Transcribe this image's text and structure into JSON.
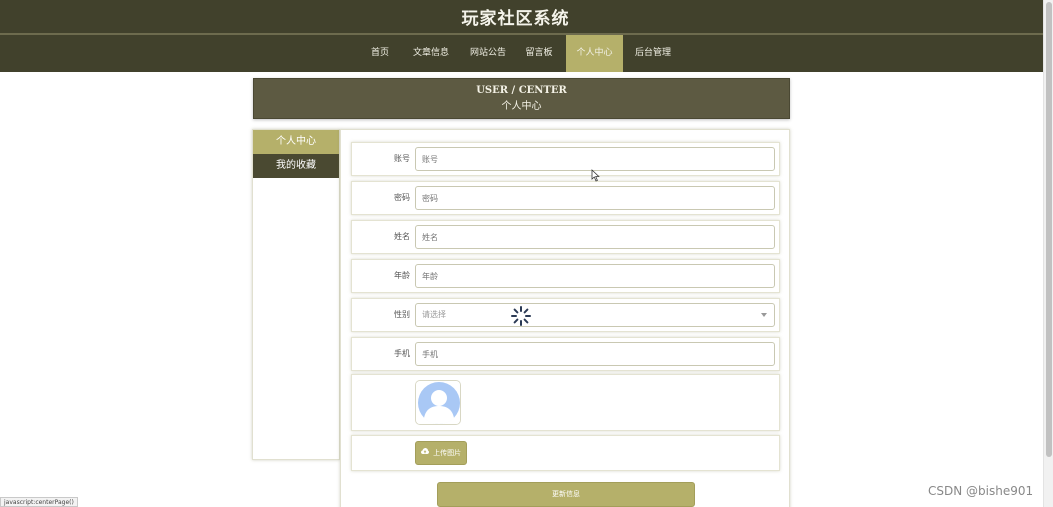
{
  "header": {
    "site_title": "玩家社区系统",
    "nav": [
      "首页",
      "文章信息",
      "网站公告",
      "留言板",
      "个人中心",
      "后台管理"
    ],
    "active_nav": "个人中心"
  },
  "banner": {
    "en": "USER / CENTER",
    "cn": "个人中心"
  },
  "sidebar": {
    "items": [
      "个人中心",
      "我的收藏"
    ]
  },
  "form": {
    "fields": [
      {
        "label": "账号",
        "placeholder": "账号"
      },
      {
        "label": "密码",
        "placeholder": "密码"
      },
      {
        "label": "姓名",
        "placeholder": "姓名"
      },
      {
        "label": "年龄",
        "placeholder": "年龄"
      },
      {
        "label": "性别",
        "placeholder": "请选择"
      },
      {
        "label": "手机",
        "placeholder": "手机"
      }
    ],
    "upload_label": "上传图片",
    "update_label": "更新信息"
  },
  "status_bar": "javascript:centerPage()",
  "watermark": "CSDN @bishe901",
  "colors": {
    "header_bg": "#41412c",
    "accent": "#b5b06a",
    "banner_bg": "#5d5a42",
    "sidebar_dark": "#4a4931"
  },
  "icons": {
    "avatar": "user-avatar-icon",
    "upload": "cloud-upload-icon",
    "spinner": "loading-spinner-icon",
    "cursor": "mouse-pointer-icon",
    "select": "chevron-down-icon"
  }
}
